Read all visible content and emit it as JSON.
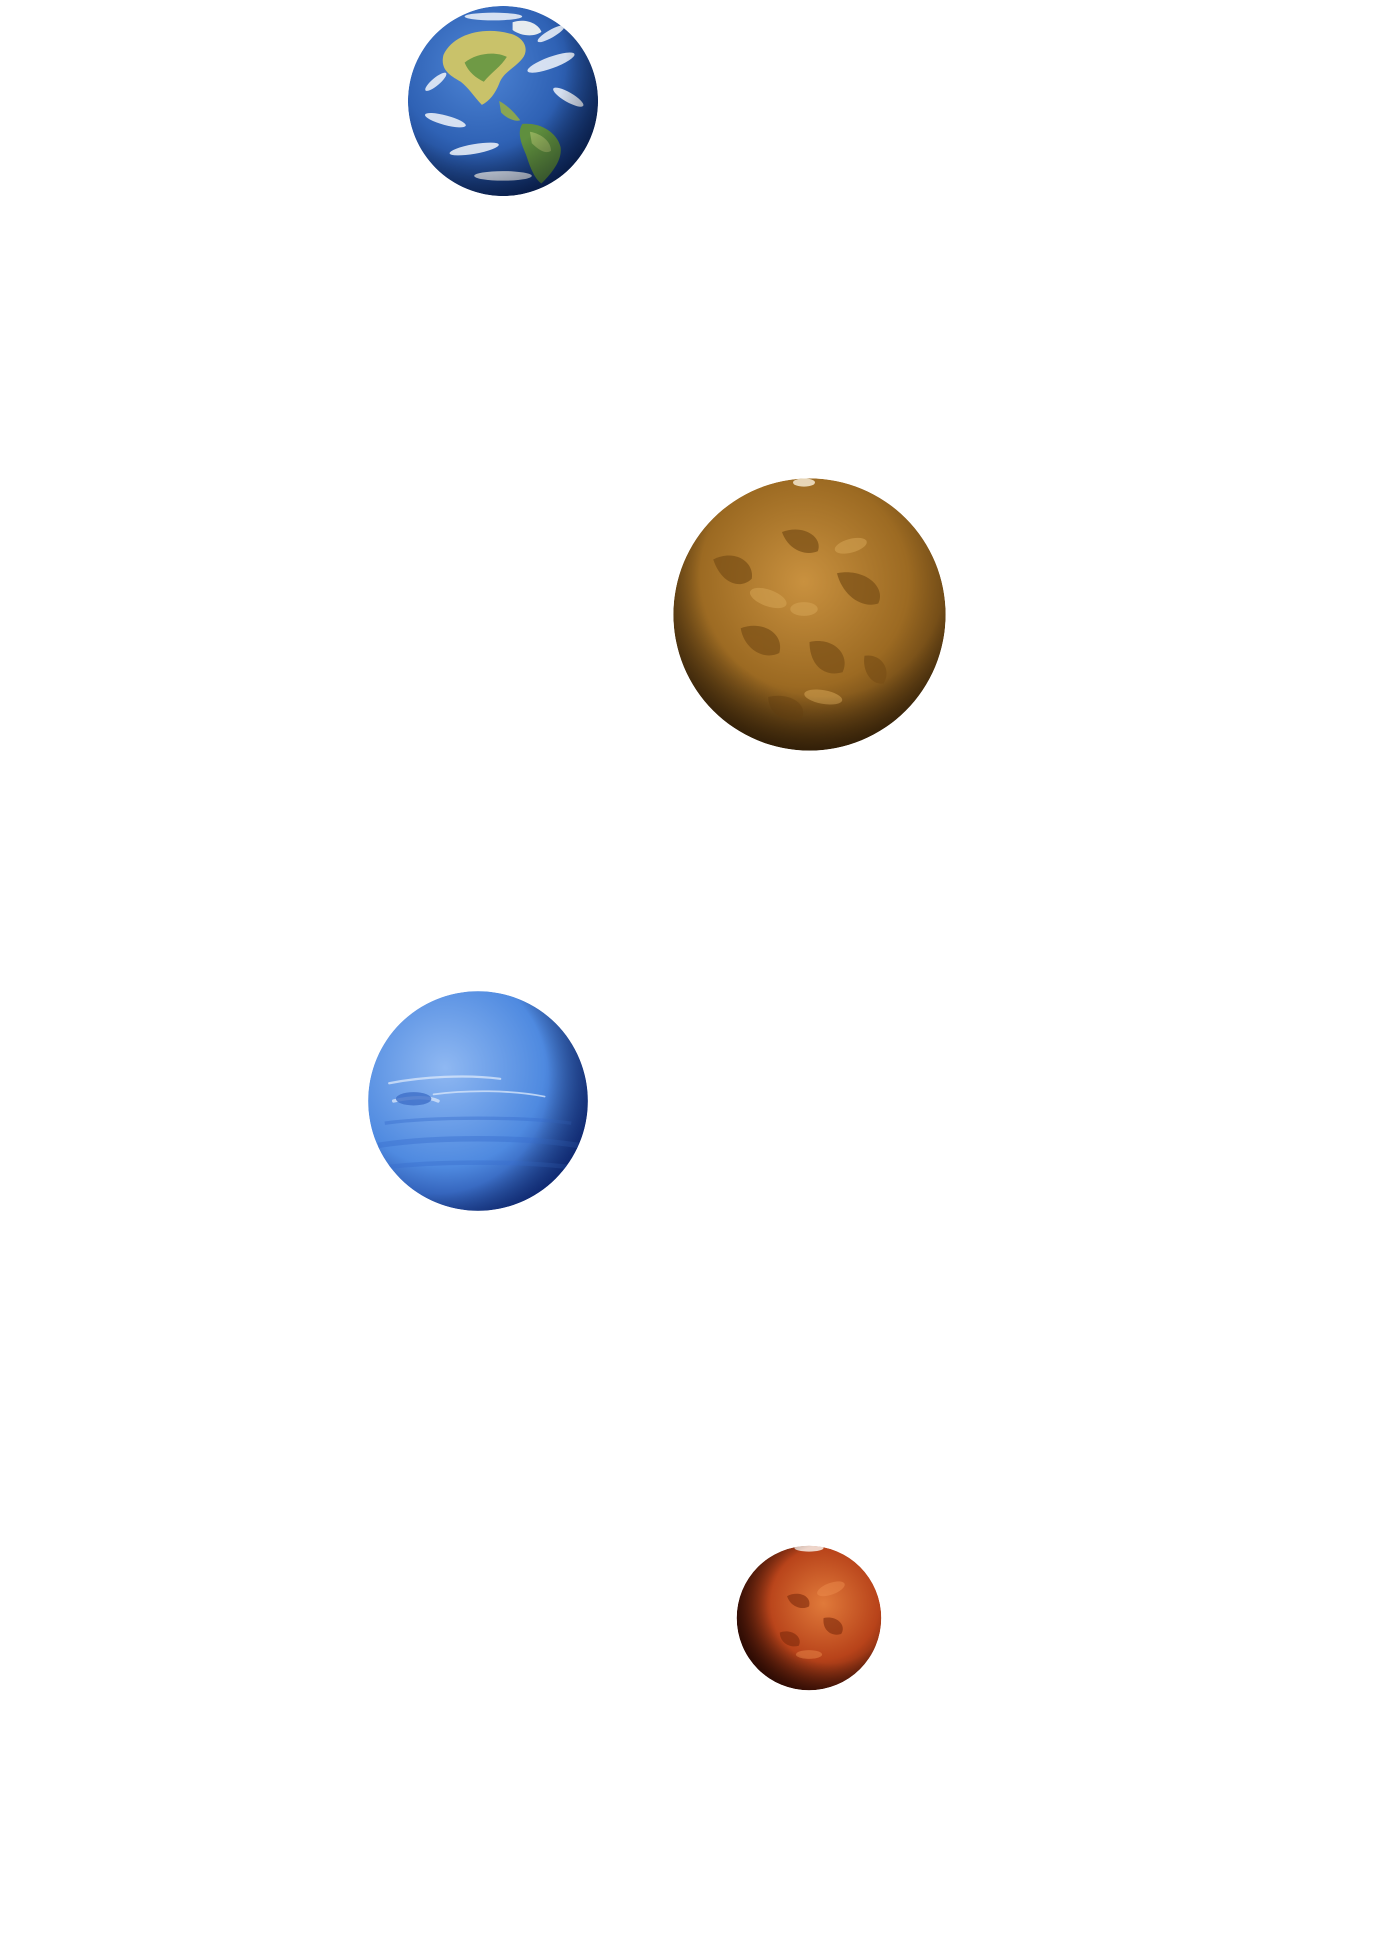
{
  "scene": {
    "background_color": "#ffffff",
    "planets": [
      {
        "name": "earth",
        "colors": {
          "ocean": "#2f62b5",
          "ocean_dark": "#0d2a66",
          "land": "#c9c26a",
          "land_green": "#5f8f3e",
          "cloud": "#f2f6fb"
        }
      },
      {
        "name": "venus",
        "colors": {
          "light": "#c9913f",
          "mid": "#9c6a22",
          "dark": "#3a2308",
          "spot": "#7a4f16"
        }
      },
      {
        "name": "neptune",
        "colors": {
          "light": "#8fb8f2",
          "mid": "#4f8ae0",
          "dark": "#0f2f8a",
          "band": "#dce9fb"
        }
      },
      {
        "name": "mars",
        "colors": {
          "light": "#e07a3a",
          "mid": "#b8431a",
          "dark": "#3a0c04",
          "cap": "#f4e6de"
        }
      }
    ]
  }
}
